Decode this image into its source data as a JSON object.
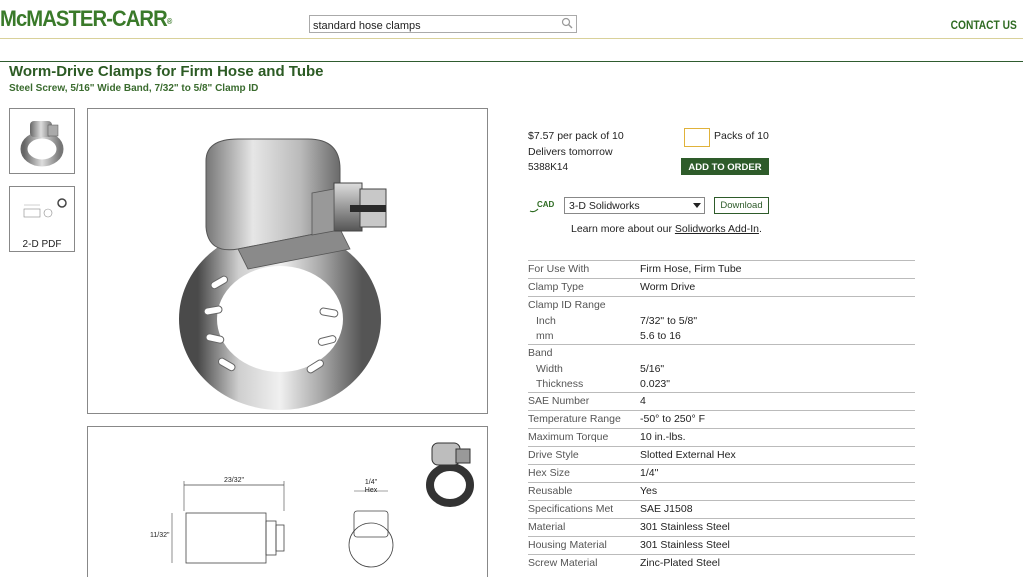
{
  "header": {
    "logo_text": "McMASTER-CARR",
    "logo_mark": "®",
    "search_value": "standard hose clamps",
    "contact_label": "CONTACT US"
  },
  "product": {
    "title": "Worm-Drive Clamps for Firm Hose and Tube",
    "subtitle": "Steel Screw, 5/16\" Wide Band, 7/32\" to 5/8\" Clamp ID",
    "thumb_pdf_label": "2-D PDF"
  },
  "order": {
    "price": "$7.57 per pack of 10",
    "delivery": "Delivers tomorrow",
    "part_number": "5388K14",
    "qty_value": "",
    "packs_label": "Packs of 10",
    "add_button": "ADD TO ORDER"
  },
  "cad": {
    "logo": "CAD",
    "selected_format": "3-D Solidworks",
    "download_button": "Download",
    "learn_prefix": "Learn more about our ",
    "learn_link": "Solidworks Add-In",
    "learn_suffix": "."
  },
  "drawing": {
    "dim_width": "23/32\"",
    "dim_height": "11/32\"",
    "dim_hex": "1/4\"",
    "dim_hex_label": "Hex"
  },
  "specs": [
    {
      "k": "For Use With",
      "v": "Firm Hose, Firm Tube",
      "type": "row"
    },
    {
      "k": "Clamp Type",
      "v": "Worm Drive",
      "type": "row"
    },
    {
      "k": "Clamp ID Range",
      "v": "",
      "type": "header"
    },
    {
      "k": "Inch",
      "v": "7/32\" to 5/8\"",
      "type": "sub"
    },
    {
      "k": "mm",
      "v": "5.6 to 16",
      "type": "sub"
    },
    {
      "k": "Band",
      "v": "",
      "type": "header"
    },
    {
      "k": "Width",
      "v": "5/16\"",
      "type": "sub"
    },
    {
      "k": "Thickness",
      "v": "0.023\"",
      "type": "sub"
    },
    {
      "k": "SAE Number",
      "v": "4",
      "type": "row"
    },
    {
      "k": "Temperature Range",
      "v": "-50° to 250° F",
      "type": "row"
    },
    {
      "k": "Maximum Torque",
      "v": "10 in.-lbs.",
      "type": "row"
    },
    {
      "k": "Drive Style",
      "v": "Slotted External Hex",
      "type": "row"
    },
    {
      "k": "Hex Size",
      "v": "1/4\"",
      "type": "row"
    },
    {
      "k": "Reusable",
      "v": "Yes",
      "type": "row"
    },
    {
      "k": "Specifications Met",
      "v": "SAE J1508",
      "type": "row"
    },
    {
      "k": "Material",
      "v": "301 Stainless Steel",
      "type": "row"
    },
    {
      "k": "Housing Material",
      "v": "301 Stainless Steel",
      "type": "row"
    },
    {
      "k": "Screw Material",
      "v": "Zinc-Plated Steel",
      "type": "row"
    }
  ]
}
